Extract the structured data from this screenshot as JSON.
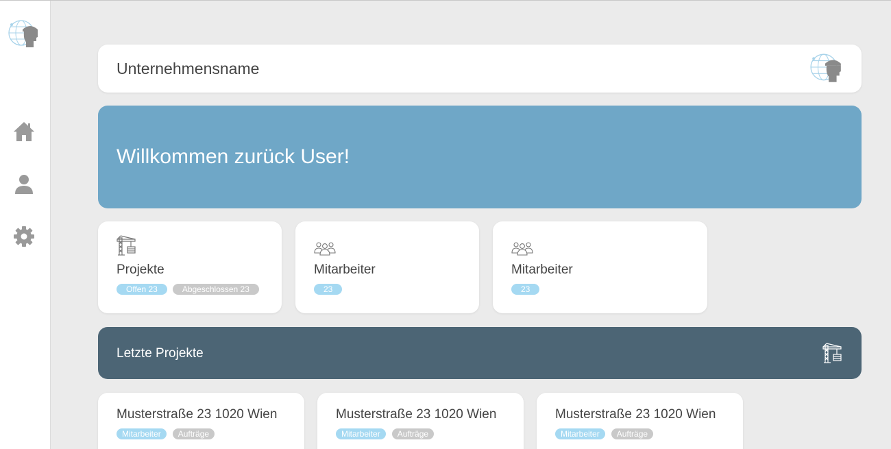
{
  "header": {
    "company_name": "Unternehmensname"
  },
  "welcome": {
    "text": "Willkommen zurück User!"
  },
  "sidebar": {
    "items": [
      {
        "icon": "home-icon"
      },
      {
        "icon": "user-icon"
      },
      {
        "icon": "gear-icon"
      }
    ]
  },
  "stats": [
    {
      "icon": "crane-icon",
      "title": "Projekte",
      "badges": [
        "Offen 23",
        "Abgeschlossen 23"
      ]
    },
    {
      "icon": "team-icon",
      "title": "Mitarbeiter",
      "badges": [
        "23"
      ]
    },
    {
      "icon": "team-icon",
      "title": "Mitarbeiter",
      "badges": [
        "23"
      ]
    }
  ],
  "recent": {
    "title": "Letzte Projekte",
    "icon": "crane-icon"
  },
  "projects": [
    {
      "title": "Musterstraße 23 1020 Wien",
      "badges": [
        "Mitarbeiter",
        "Aufträge"
      ]
    },
    {
      "title": "Musterstraße 23 1020 Wien",
      "badges": [
        "Mitarbeiter",
        "Aufträge"
      ]
    },
    {
      "title": "Musterstraße 23 1020 Wien",
      "badges": [
        "Mitarbeiter",
        "Aufträge"
      ]
    }
  ],
  "colors": {
    "accent_blue": "#6fa7c7",
    "dark_bar": "#4c6575",
    "badge_blue": "#a5d9f2",
    "badge_grey": "#c9c9c9",
    "icon_grey": "#9a9a9a"
  }
}
